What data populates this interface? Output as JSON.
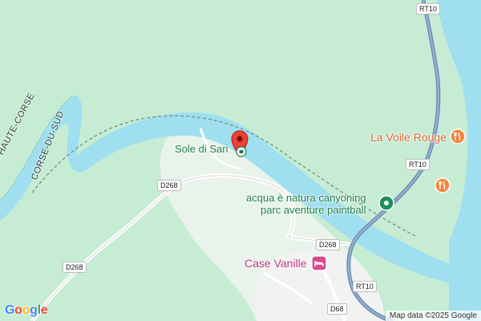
{
  "map": {
    "colors": {
      "forest": "#c7ecd4",
      "water": "#9fdff0",
      "road": "#ffffff",
      "highway": "#6f8db5",
      "pin": "#ea4335"
    },
    "marker": {
      "title": "Sole di Sari",
      "icon": "map-pin-icon"
    },
    "pois": [
      {
        "name": "La Voile Rouge",
        "icon": "restaurant-icon"
      },
      {
        "name_line1": "acqua è natura canyoning",
        "name_line2": "parc aventure paintball",
        "icon": "activity-icon"
      },
      {
        "name": "Case Vanille",
        "icon": "hotel-icon"
      }
    ],
    "unnamed_icons": [
      "restaurant-icon"
    ],
    "admin_labels": {
      "a": "HAUTE-CORSE",
      "b": "CORSE-DU-SUD"
    },
    "road_labels": {
      "rt10_top": "RT10",
      "rt10_mid": "RT10",
      "rt10_bottom": "RT10",
      "d268_a": "D268",
      "d268_b": "D268",
      "d268_c": "D268",
      "d68": "D68"
    },
    "attribution": "Map data ©2025 Google",
    "logo": "Google"
  }
}
